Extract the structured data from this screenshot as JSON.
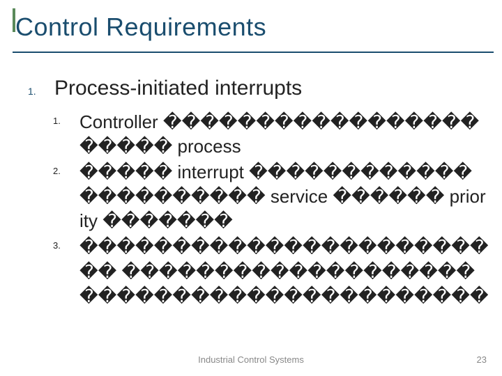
{
  "slide": {
    "title": "Control Requirements",
    "level1": {
      "num": "1.",
      "text": "Process-initiated interrupts"
    },
    "level2": [
      {
        "num": "1.",
        "text": "Controller ���������������������� process"
      },
      {
        "num": "2.",
        "text": "����� interrupt ���������������������� service ������ priority �������"
      },
      {
        "num": "3.",
        "text": "������������������������ ������������������� ����������������������"
      }
    ],
    "footer": "Industrial Control Systems",
    "page": "23"
  }
}
